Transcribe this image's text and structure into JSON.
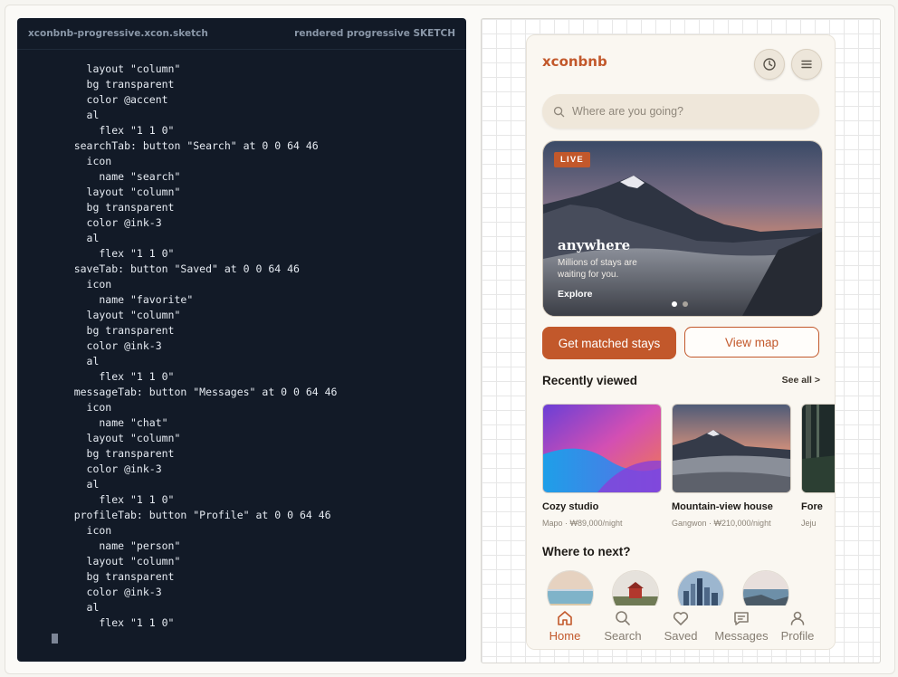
{
  "editor": {
    "filename": "xconbnb-progressive.xcon.sketch",
    "status": "rendered progressive SKETCH",
    "lines": [
      "      layout \"column\"",
      "      bg transparent",
      "      color @accent",
      "      al",
      "        flex \"1 1 0\"",
      "    searchTab: button \"Search\" at 0 0 64 46",
      "      icon",
      "        name \"search\"",
      "      layout \"column\"",
      "      bg transparent",
      "      color @ink-3",
      "      al",
      "        flex \"1 1 0\"",
      "    saveTab: button \"Saved\" at 0 0 64 46",
      "      icon",
      "        name \"favorite\"",
      "      layout \"column\"",
      "      bg transparent",
      "      color @ink-3",
      "      al",
      "        flex \"1 1 0\"",
      "    messageTab: button \"Messages\" at 0 0 64 46",
      "      icon",
      "        name \"chat\"",
      "      layout \"column\"",
      "      bg transparent",
      "      color @ink-3",
      "      al",
      "        flex \"1 1 0\"",
      "    profileTab: button \"Profile\" at 0 0 64 46",
      "      icon",
      "        name \"person\"",
      "      layout \"column\"",
      "      bg transparent",
      "      color @ink-3",
      "      al",
      "        flex \"1 1 0\""
    ]
  },
  "app": {
    "brand": "xconbnb",
    "search_placeholder": "Where are you going?",
    "hero": {
      "badge": "LIVE",
      "title": "anywhere",
      "subtitle": "Millions of stays are waiting for you.",
      "cta": "Explore"
    },
    "primary_button": "Get matched stays",
    "secondary_button": "View map",
    "recently_viewed": {
      "title": "Recently viewed",
      "see_all": "See all >",
      "cards": [
        {
          "title": "Cozy studio",
          "subtitle": "Mapo · ₩89,000/night"
        },
        {
          "title": "Mountain-view house",
          "subtitle": "Gangwon · ₩210,000/night"
        },
        {
          "title": "Fore",
          "subtitle": "Jeju"
        }
      ]
    },
    "where_next": {
      "title": "Where to next?"
    },
    "tabs": [
      {
        "label": "Home",
        "icon": "home-icon"
      },
      {
        "label": "Search",
        "icon": "search-icon"
      },
      {
        "label": "Saved",
        "icon": "heart-icon"
      },
      {
        "label": "Messages",
        "icon": "chat-icon"
      },
      {
        "label": "Profile",
        "icon": "person-icon"
      }
    ],
    "colors": {
      "accent": "#c2582b",
      "ink": "#1d1a16",
      "editor_bg": "#121a27"
    }
  }
}
